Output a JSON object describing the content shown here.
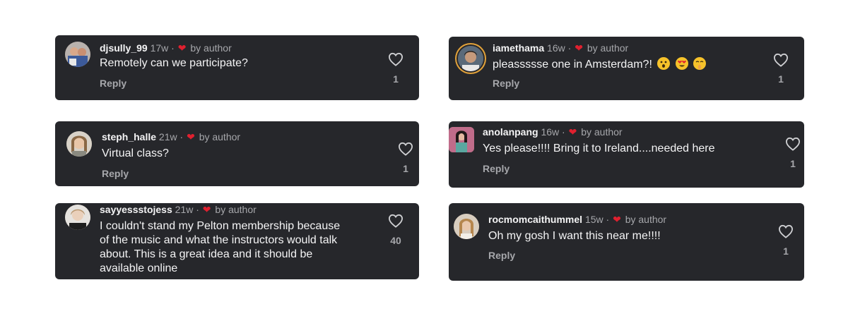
{
  "comments": [
    {
      "username": "djsully_99",
      "time": "17w",
      "badge": "by author",
      "text": "Remotely can we participate?",
      "reply": "Reply",
      "likes": "1"
    },
    {
      "username": "steph_halle",
      "time": "21w",
      "badge": "by author",
      "text": "Virtual class?",
      "reply": "Reply",
      "likes": "1"
    },
    {
      "username": "sayyesss​tojess",
      "time": "21w",
      "badge": "by author",
      "text_lines": [
        "I couldn't stand my Pelton membership because",
        "of the music and what the instructors would talk",
        "about. This is a great idea and it should be",
        "available online"
      ],
      "reply": "",
      "likes": "40"
    },
    {
      "username": "iamethama",
      "time": "16w",
      "badge": "by author",
      "text": "pleassssse one in Amsterdam?!",
      "emojis": [
        "astonished-emoji",
        "heart-eyes-emoji",
        "shushing-emoji"
      ],
      "reply": "Reply",
      "likes": "1"
    },
    {
      "username": "anolanpang",
      "time": "16w",
      "badge": "by author",
      "text": "Yes please!!!! Bring it to Ireland....needed here",
      "reply": "Reply",
      "likes": "1"
    },
    {
      "username": "rocmomcaithummel",
      "time": "15w",
      "badge": "by author",
      "text": "Oh my gosh I want this near me!!!!",
      "reply": "Reply",
      "likes": "1"
    }
  ],
  "icons": {
    "like": "heart-outline-icon",
    "author_like": "red-heart-icon"
  },
  "colors": {
    "card": "#26272b",
    "author_heart": "#e0202f",
    "muted": "#a6a7ab",
    "text": "#f4f4f5"
  }
}
